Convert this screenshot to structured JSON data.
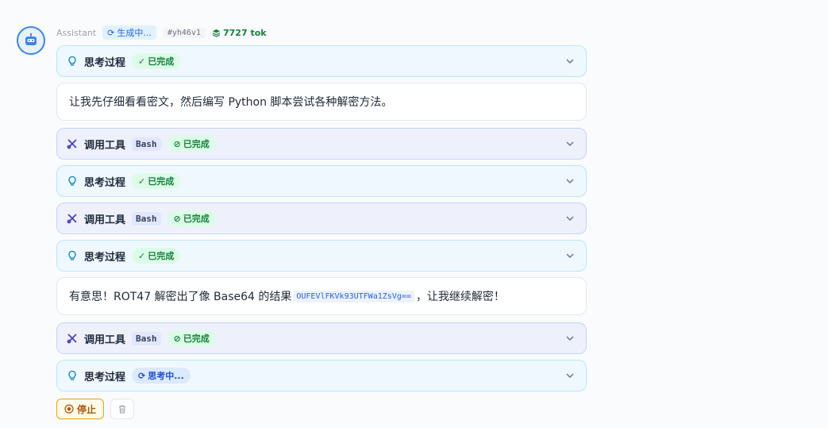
{
  "meta": {
    "role": "Assistant",
    "status": "生成中...",
    "hash": "#yh46v1",
    "tokens": "7727 tok"
  },
  "labels": {
    "thinking": "思考过程",
    "tool_call": "调用工具",
    "done": "已完成",
    "thinking_in_progress": "思考中..."
  },
  "blocks": [
    {
      "kind": "thinking",
      "status": "已完成"
    },
    {
      "kind": "text",
      "text": "让我先仔细看看密文，然后编写 Python 脚本尝试各种解密方法。"
    },
    {
      "kind": "tool",
      "tool": "Bash",
      "status": "已完成"
    },
    {
      "kind": "thinking",
      "status": "已完成"
    },
    {
      "kind": "tool",
      "tool": "Bash",
      "status": "已完成"
    },
    {
      "kind": "thinking",
      "status": "已完成"
    },
    {
      "kind": "text",
      "text_before": "有意思！ROT47 解密出了像 Base64 的结果",
      "code": "OUFEVlFKVk93UTFWa1ZsVg==",
      "text_after": "，让我继续解密！"
    },
    {
      "kind": "tool",
      "tool": "Bash",
      "status": "已完成"
    },
    {
      "kind": "thinking",
      "status": "思考中..."
    }
  ],
  "actions": {
    "stop_label": "停止"
  }
}
